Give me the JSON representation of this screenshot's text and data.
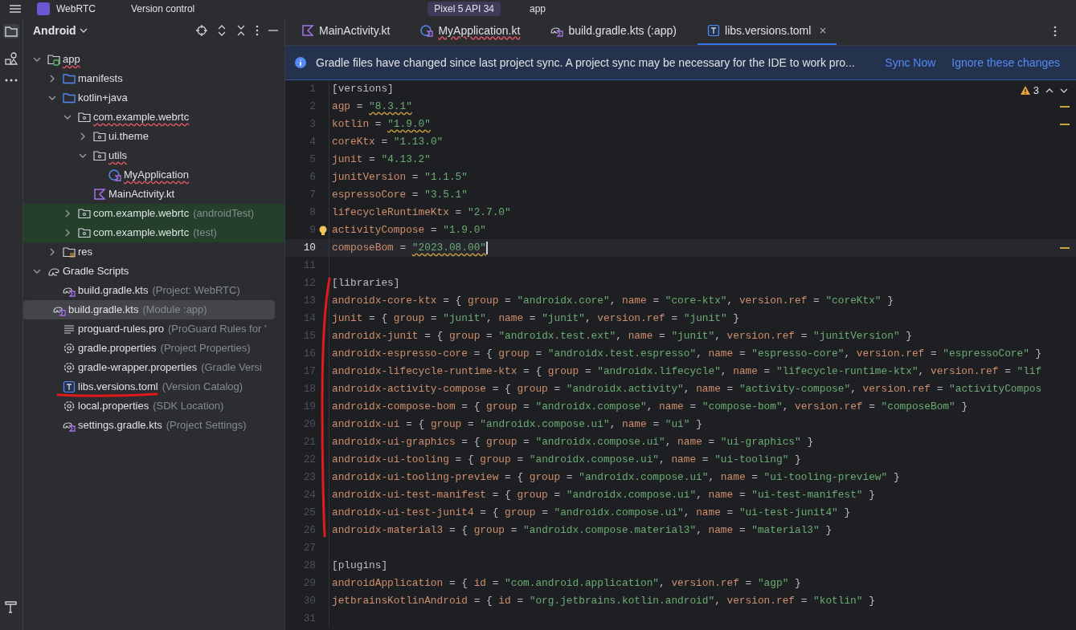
{
  "top_bar": {
    "project": "WebRTC",
    "vcs": "Version control",
    "device": "Pixel 5 API 34",
    "run_config": "app"
  },
  "project_panel": {
    "title": "Android",
    "tree": [
      {
        "label": "app",
        "kind": "module",
        "expanded": true,
        "selected": false,
        "test_scope": false,
        "squiggle": true,
        "children": [
          {
            "label": "manifests",
            "kind": "folder",
            "expanded": false,
            "selected": false,
            "test_scope": false,
            "squiggle": false
          },
          {
            "label": "kotlin+java",
            "kind": "folder",
            "expanded": true,
            "selected": false,
            "test_scope": false,
            "squiggle": false,
            "children": [
              {
                "label": "com.example.webrtc",
                "kind": "package",
                "expanded": true,
                "selected": false,
                "test_scope": false,
                "squiggle": true,
                "children": [
                  {
                    "label": "ui.theme",
                    "kind": "package",
                    "expanded": false,
                    "selected": false,
                    "test_scope": false,
                    "squiggle": false
                  },
                  {
                    "label": "utils",
                    "kind": "package",
                    "expanded": true,
                    "selected": false,
                    "test_scope": false,
                    "squiggle": true,
                    "children": [
                      {
                        "label": "MyApplication",
                        "kind": "class",
                        "selected": false,
                        "test_scope": false,
                        "squiggle": true
                      }
                    ]
                  },
                  {
                    "label": "MainActivity.kt",
                    "kind": "kotlin",
                    "selected": false,
                    "test_scope": false,
                    "squiggle": false
                  }
                ]
              },
              {
                "label": "com.example.webrtc",
                "suffix": "(androidTest)",
                "kind": "package",
                "expanded": false,
                "selected": false,
                "test_scope": true,
                "squiggle": false
              },
              {
                "label": "com.example.webrtc",
                "suffix": "(test)",
                "kind": "package",
                "expanded": false,
                "selected": false,
                "test_scope": true,
                "squiggle": false
              }
            ]
          },
          {
            "label": "res",
            "kind": "res",
            "expanded": false,
            "selected": false,
            "test_scope": false,
            "squiggle": false
          }
        ]
      },
      {
        "label": "Gradle Scripts",
        "kind": "gradle",
        "expanded": true,
        "selected": false,
        "test_scope": false,
        "squiggle": false,
        "children": [
          {
            "label": "build.gradle.kts",
            "suffix": "(Project: WebRTC)",
            "kind": "gradle-kts",
            "selected": false,
            "test_scope": false,
            "squiggle": false
          },
          {
            "label": "build.gradle.kts",
            "suffix": "(Module :app)",
            "kind": "gradle-kts",
            "selected": true,
            "test_scope": false,
            "squiggle": false
          },
          {
            "label": "proguard-rules.pro",
            "suffix": "(ProGuard Rules for '",
            "kind": "text",
            "selected": false,
            "test_scope": false,
            "squiggle": false
          },
          {
            "label": "gradle.properties",
            "suffix": "(Project Properties)",
            "kind": "settings",
            "selected": false,
            "test_scope": false,
            "squiggle": false
          },
          {
            "label": "gradle-wrapper.properties",
            "suffix": "(Gradle Versi",
            "kind": "settings",
            "selected": false,
            "test_scope": false,
            "squiggle": false
          },
          {
            "label": "libs.versions.toml",
            "suffix": "(Version Catalog)",
            "kind": "toml",
            "selected": false,
            "test_scope": false,
            "squiggle": false
          },
          {
            "label": "local.properties",
            "suffix": "(SDK Location)",
            "kind": "settings",
            "selected": false,
            "test_scope": false,
            "squiggle": false
          },
          {
            "label": "settings.gradle.kts",
            "suffix": "(Project Settings)",
            "kind": "gradle-kts",
            "selected": false,
            "test_scope": false,
            "squiggle": false
          }
        ]
      }
    ]
  },
  "editor_tabs": [
    {
      "label": "MainActivity.kt",
      "kind": "kotlin",
      "selected": false,
      "squiggle": false
    },
    {
      "label": "MyApplication.kt",
      "kind": "class",
      "selected": false,
      "squiggle": true
    },
    {
      "label": "build.gradle.kts (:app)",
      "kind": "gradle-kts",
      "selected": false,
      "squiggle": false
    },
    {
      "label": "libs.versions.toml",
      "kind": "toml",
      "selected": true,
      "squiggle": false
    }
  ],
  "banner": {
    "message": "Gradle files have changed since last project sync. A project sync may be necessary for the IDE to work pro...",
    "actions": [
      "Sync Now",
      "Ignore these changes"
    ]
  },
  "inspections": {
    "warnings": "3"
  },
  "code": [
    {
      "n": "1",
      "text": "[versions]",
      "current": false,
      "warning": false
    },
    {
      "n": "2",
      "text": "agp = \"8.3.1\"",
      "current": false,
      "warning": true
    },
    {
      "n": "3",
      "text": "kotlin = \"1.9.0\"",
      "current": false,
      "warning": true
    },
    {
      "n": "4",
      "text": "coreKtx = \"1.13.0\"",
      "current": false,
      "warning": false
    },
    {
      "n": "5",
      "text": "junit = \"4.13.2\"",
      "current": false,
      "warning": false
    },
    {
      "n": "6",
      "text": "junitVersion = \"1.1.5\"",
      "current": false,
      "warning": false
    },
    {
      "n": "7",
      "text": "espressoCore = \"3.5.1\"",
      "current": false,
      "warning": false
    },
    {
      "n": "8",
      "text": "lifecycleRuntimeKtx = \"2.7.0\"",
      "current": false,
      "warning": false
    },
    {
      "n": "9",
      "text": "activityCompose = \"1.9.0\"",
      "current": false,
      "warning": false,
      "bulb": true
    },
    {
      "n": "10",
      "text": "composeBom = \"2023.08.00\"",
      "current": true,
      "warning": true
    },
    {
      "n": "11",
      "current": false,
      "warning": false
    },
    {
      "n": "12",
      "text": "[libraries]",
      "current": false,
      "warning": false
    },
    {
      "n": "13",
      "text": "androidx-core-ktx = { group = \"androidx.core\", name = \"core-ktx\", version.ref = \"coreKtx\" }",
      "current": false,
      "warning": false
    },
    {
      "n": "14",
      "text": "junit = { group = \"junit\", name = \"junit\", version.ref = \"junit\" }",
      "current": false,
      "warning": false
    },
    {
      "n": "15",
      "text": "androidx-junit = { group = \"androidx.test.ext\", name = \"junit\", version.ref = \"junitVersion\" }",
      "current": false,
      "warning": false
    },
    {
      "n": "16",
      "text": "androidx-espresso-core = { group = \"androidx.test.espresso\", name = \"espresso-core\", version.ref = \"espressoCore\" }",
      "current": false,
      "warning": false
    },
    {
      "n": "17",
      "text": "androidx-lifecycle-runtime-ktx = { group = \"androidx.lifecycle\", name = \"lifecycle-runtime-ktx\", version.ref = \"lif",
      "current": false,
      "warning": false
    },
    {
      "n": "18",
      "text": "androidx-activity-compose = { group = \"androidx.activity\", name = \"activity-compose\", version.ref = \"activityCompos",
      "current": false,
      "warning": false
    },
    {
      "n": "19",
      "text": "androidx-compose-bom = { group = \"androidx.compose\", name = \"compose-bom\", version.ref = \"composeBom\" }",
      "current": false,
      "warning": false
    },
    {
      "n": "20",
      "text": "androidx-ui = { group = \"androidx.compose.ui\", name = \"ui\" }",
      "current": false,
      "warning": false
    },
    {
      "n": "21",
      "text": "androidx-ui-graphics = { group = \"androidx.compose.ui\", name = \"ui-graphics\" }",
      "current": false,
      "warning": false
    },
    {
      "n": "22",
      "text": "androidx-ui-tooling = { group = \"androidx.compose.ui\", name = \"ui-tooling\" }",
      "current": false,
      "warning": false
    },
    {
      "n": "23",
      "text": "androidx-ui-tooling-preview = { group = \"androidx.compose.ui\", name = \"ui-tooling-preview\" }",
      "current": false,
      "warning": false
    },
    {
      "n": "24",
      "text": "androidx-ui-test-manifest = { group = \"androidx.compose.ui\", name = \"ui-test-manifest\" }",
      "current": false,
      "warning": false
    },
    {
      "n": "25",
      "text": "androidx-ui-test-junit4 = { group = \"androidx.compose.ui\", name = \"ui-test-junit4\" }",
      "current": false,
      "warning": false
    },
    {
      "n": "26",
      "text": "androidx-material3 = { group = \"androidx.compose.material3\", name = \"material3\" }",
      "current": false,
      "warning": false
    },
    {
      "n": "27",
      "current": false,
      "warning": false
    },
    {
      "n": "28",
      "text": "[plugins]",
      "current": false,
      "warning": false
    },
    {
      "n": "29",
      "text": "androidApplication = { id = \"com.android.application\", version.ref = \"agp\" }",
      "current": false,
      "warning": false
    },
    {
      "n": "30",
      "text": "jetbrainsKotlinAndroid = { id = \"org.jetbrains.kotlin.android\", version.ref = \"kotlin\" }",
      "current": false,
      "warning": false
    },
    {
      "n": "31",
      "current": false,
      "warning": false
    }
  ]
}
